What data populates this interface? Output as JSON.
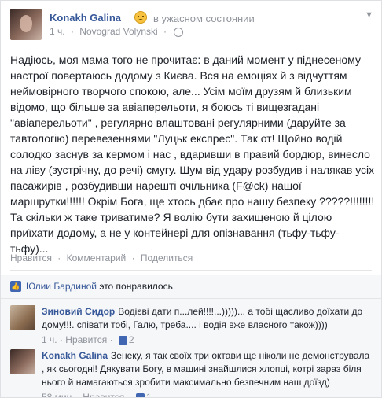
{
  "post": {
    "author": "Konakh Galina",
    "feeling": "в ужасном состоянии",
    "time": "1 ч.",
    "location": "Novograd Volynski",
    "text": "Надіюсь, моя мама того не прочитає: в даний момент у піднесеному настрої повертаюсь додому з Києва. Вся на емоціях й з відчуттям неймовірного творчого спокою, але... Усім моїм друзям й близьким відомо, що більше за авіаперельоти, я боюсь ті вищезгадані \"авіаперельоти\" , регулярно влаштовані регулярними (даруйте за тавтологію) перевезеннями \"Луцьк експрес\". Так от! Щойно водій солодко заснув за кермом і нас , вдаривши в правий бордюр, винесло на ліву (зустрічну, до речі) смугу. Шум від удару розбудив і налякав усіх пасажирів , розбудивши нарешті очільника (F@ck) нашої маршрутки!!!!!! Окрім Бога, ще хтось дбає про нашу безпеку ?????!!!!!!!!Та скільки ж таке триватиме? Я волію бути захищеною й цілою приїхати додому, а не у контейнері для опізнавання (тьфу-тьфу-тьфу)..."
  },
  "actions": {
    "like": "Нравится",
    "comment": "Комментарий",
    "share": "Поделиться"
  },
  "likes": {
    "who": "Юлии Бардиной",
    "rest": "это понравилось."
  },
  "comments": [
    {
      "author": "Зиновий Сидор",
      "text": "Водієві дати п...лей!!!!...)))))... а тобі щасливо доїхати до дому!!!. співати тобі, Галю, треба.... і водія вже власного також))))",
      "time": "1 ч.",
      "like": "Нравится",
      "count": "2"
    },
    {
      "author": "Konakh Galina",
      "text": "Зенеку, я так своїх три октави ще ніколи не демонструвала , як сьогодні! Дякувати Богу, в машині знайшлися хлопці, котрі зараз біля нього й намагаються зробити максимально безпечним наш доїзд)",
      "time": "58 мин.",
      "like": "Нравится",
      "count": "1"
    }
  ],
  "colors": {
    "link": "#365899",
    "muted": "#90949c",
    "text": "#1d2129",
    "brand": "#4267b2"
  }
}
